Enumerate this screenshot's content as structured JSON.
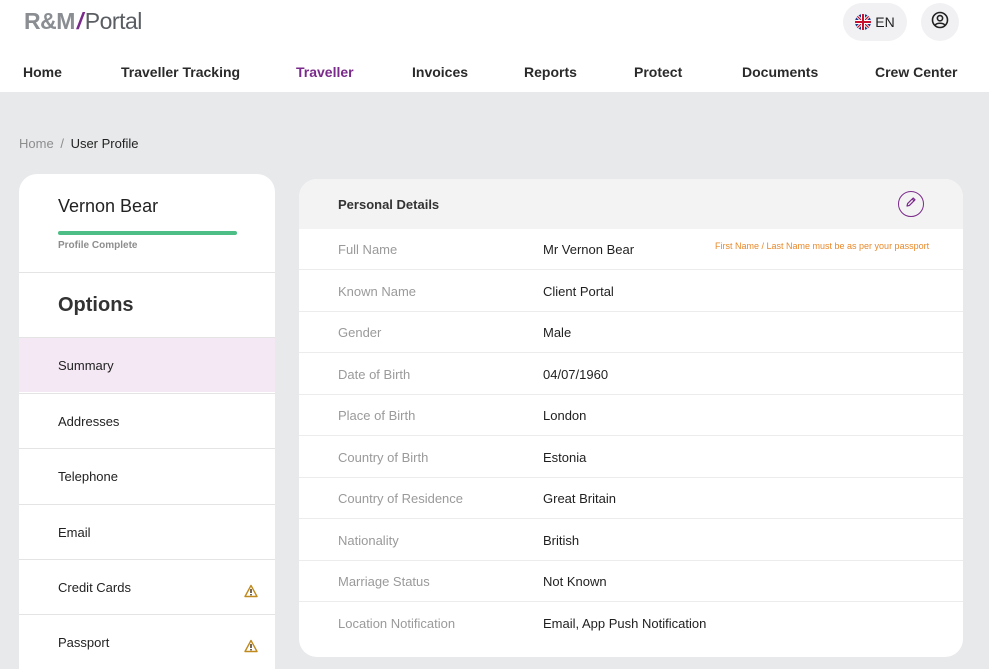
{
  "header": {
    "logo": {
      "part1": "R&M",
      "part2": "/",
      "part3": "Portal"
    },
    "language": {
      "code": "EN",
      "icon": "uk-flag-icon"
    },
    "user_icon": "user-circle-icon"
  },
  "nav": {
    "items": [
      {
        "label": "Home"
      },
      {
        "label": "Traveller Tracking"
      },
      {
        "label": "Traveller"
      },
      {
        "label": "Invoices"
      },
      {
        "label": "Reports"
      },
      {
        "label": "Protect"
      },
      {
        "label": "Documents"
      },
      {
        "label": "Crew Center"
      }
    ],
    "active": "Traveller"
  },
  "breadcrumb": {
    "home": "Home",
    "separator": "/",
    "current": "User Profile"
  },
  "sidebar": {
    "profile_name": "Vernon Bear",
    "profile_status": "Profile Complete",
    "profile_progress": 1.0,
    "options_title": "Options",
    "items": [
      {
        "label": "Summary"
      },
      {
        "label": "Addresses"
      },
      {
        "label": "Telephone"
      },
      {
        "label": "Email"
      },
      {
        "label": "Credit Cards",
        "icon": "warning-icon"
      },
      {
        "label": "Passport",
        "icon": "warning-icon"
      }
    ],
    "active": "Summary"
  },
  "details": {
    "title": "Personal Details",
    "edit_icon": "pencil-icon",
    "note": "First Name / Last Name must be as per your passport",
    "rows": [
      {
        "label": "Full Name",
        "value": "Mr Vernon Bear"
      },
      {
        "label": "Known Name",
        "value": "Client Portal"
      },
      {
        "label": "Gender",
        "value": "Male"
      },
      {
        "label": "Date of Birth",
        "value": "04/07/1960"
      },
      {
        "label": "Place of Birth",
        "value": "London"
      },
      {
        "label": "Country of Birth",
        "value": "Estonia"
      },
      {
        "label": "Country of Residence",
        "value": "Great Britain"
      },
      {
        "label": "Nationality",
        "value": "British"
      },
      {
        "label": "Marriage Status",
        "value": "Not Known"
      },
      {
        "label": "Location Notification",
        "value": "Email, App Push Notification"
      }
    ]
  },
  "colors": {
    "accent": "#7a2a8a",
    "progress": "#4dbe86",
    "warning": "#c08a1e",
    "note": "#e8892a",
    "active_bg": "#f4e8f4"
  }
}
